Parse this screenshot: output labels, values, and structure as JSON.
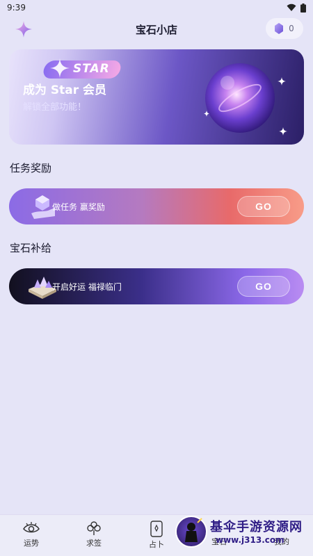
{
  "status_bar": {
    "time": "9:39"
  },
  "header": {
    "title": "宝石小店",
    "gem_count": "0"
  },
  "star_card": {
    "badge": "STAR",
    "headline": "成为 Star 会员",
    "subtitle": "解锁全部功能！"
  },
  "sections": {
    "tasks_title": "任务奖励",
    "supply_title": "宝石补给"
  },
  "task_cards": [
    {
      "label": "做任务 赢奖励",
      "button": "GO"
    },
    {
      "label": "开启好运 福禄临门",
      "button": "GO"
    }
  ],
  "bottom_nav": [
    {
      "label": "运势",
      "icon": "eye-icon"
    },
    {
      "label": "求签",
      "icon": "clover-icon"
    },
    {
      "label": "占卜",
      "icon": "tarot-card-icon"
    },
    {
      "label": "宝石",
      "icon": "gem-icon"
    },
    {
      "label": "我的",
      "icon": "profile-icon"
    }
  ],
  "watermark": {
    "title": "基伞手游资源网",
    "url": "www.j313.com"
  },
  "colors": {
    "background": "#e5e4f7",
    "accent_purple": "#8b6be6",
    "accent_coral": "#f89c88"
  }
}
